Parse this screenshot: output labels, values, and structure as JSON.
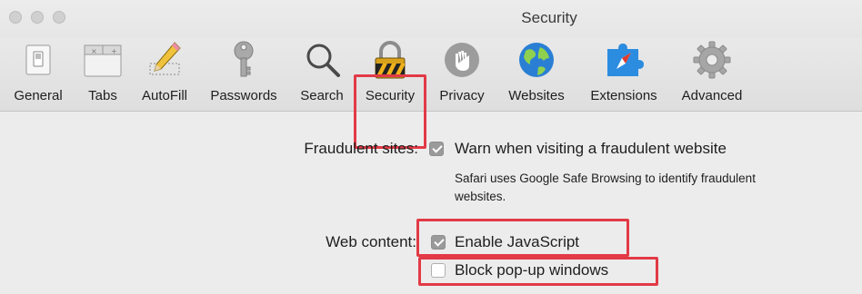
{
  "window": {
    "title": "Security"
  },
  "toolbar": {
    "tabs": [
      {
        "label": "General",
        "icon": "switch-icon"
      },
      {
        "label": "Tabs",
        "icon": "tabs-icon"
      },
      {
        "label": "AutoFill",
        "icon": "pencil-icon"
      },
      {
        "label": "Passwords",
        "icon": "key-icon"
      },
      {
        "label": "Search",
        "icon": "magnifier-icon"
      },
      {
        "label": "Security",
        "icon": "lock-icon",
        "selected": true
      },
      {
        "label": "Privacy",
        "icon": "hand-icon"
      },
      {
        "label": "Websites",
        "icon": "globe-icon"
      },
      {
        "label": "Extensions",
        "icon": "puzzle-icon"
      },
      {
        "label": "Advanced",
        "icon": "gear-icon"
      }
    ]
  },
  "security": {
    "fraudulent_label": "Fraudulent sites:",
    "fraudulent_option": "Warn when visiting a fraudulent website",
    "fraudulent_checked": true,
    "fraudulent_note": "Safari uses Google Safe Browsing to identify fraudulent websites.",
    "webcontent_label": "Web content:",
    "javascript_option": "Enable JavaScript",
    "javascript_checked": true,
    "popup_option": "Block pop-up windows",
    "popup_checked": false
  },
  "colors": {
    "highlight": "#e23a46",
    "checkbox_on": "#9a9a9a"
  }
}
